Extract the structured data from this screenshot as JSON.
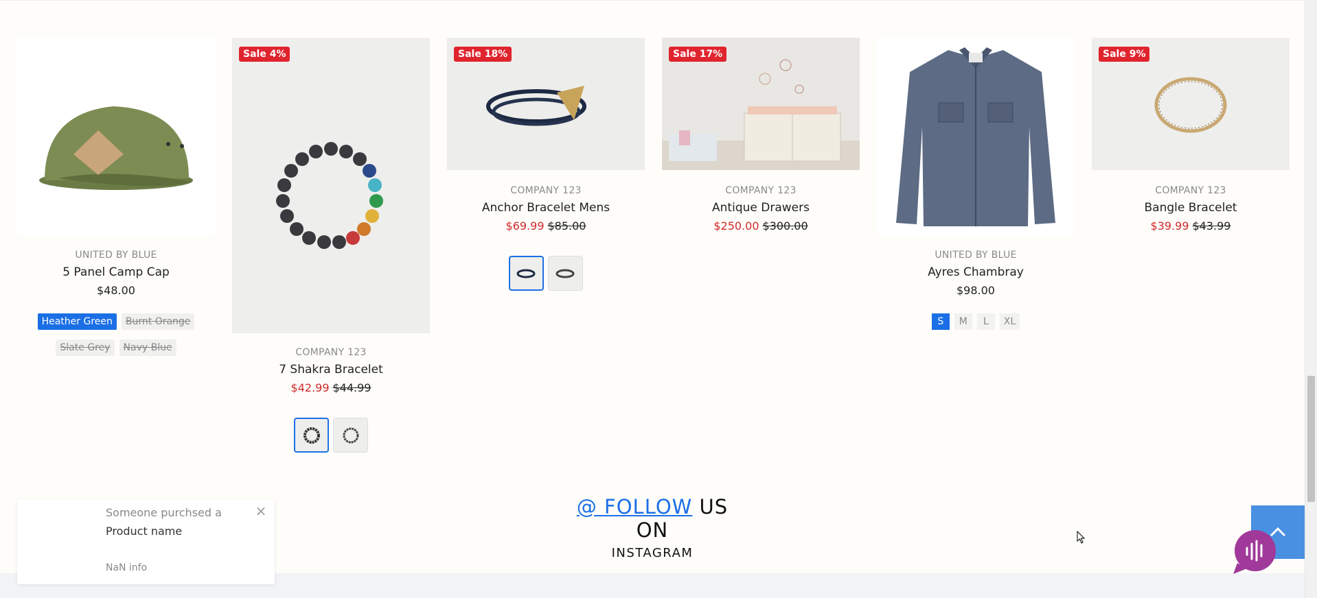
{
  "products": [
    {
      "vendor": "UNITED BY BLUE",
      "title": "5 Panel Camp Cap",
      "price": "$48.00",
      "options": [
        {
          "label": "Heather Green"
        },
        {
          "label": "Burnt Orange"
        },
        {
          "label": "Slate Grey"
        },
        {
          "label": "Navy Blue"
        }
      ]
    },
    {
      "badge": "Sale 4%",
      "vendor": "COMPANY 123",
      "title": "7 Shakra Bracelet",
      "sale_price": "$42.99",
      "compare_price": "$44.99"
    },
    {
      "badge": "Sale 18%",
      "vendor": "COMPANY 123",
      "title": "Anchor Bracelet Mens",
      "sale_price": "$69.99",
      "compare_price": "$85.00"
    },
    {
      "badge": "Sale 17%",
      "vendor": "COMPANY 123",
      "title": "Antique Drawers",
      "sale_price": "$250.00",
      "compare_price": "$300.00"
    },
    {
      "vendor": "UNITED BY BLUE",
      "title": "Ayres Chambray",
      "price": "$98.00",
      "sizes": [
        "S",
        "M",
        "L",
        "XL"
      ]
    },
    {
      "badge": "Sale 9%",
      "vendor": "COMPANY 123",
      "title": "Bangle Bracelet",
      "sale_price": "$39.99",
      "compare_price": "$43.99"
    }
  ],
  "follow": {
    "link_text": "@ FOLLOW",
    "text": " US ON",
    "platform": "INSTAGRAM"
  },
  "popup": {
    "line1": "Someone purchsed a",
    "line2": "Product name",
    "line3": "NaN info",
    "close_icon": "close-icon"
  },
  "colors": {
    "accent": "#1b6fe6",
    "sale_badge": "#e0242e",
    "sale_price": "#d12a2a",
    "back_to_top": "#4a90e2",
    "chat": "#a0399a"
  }
}
